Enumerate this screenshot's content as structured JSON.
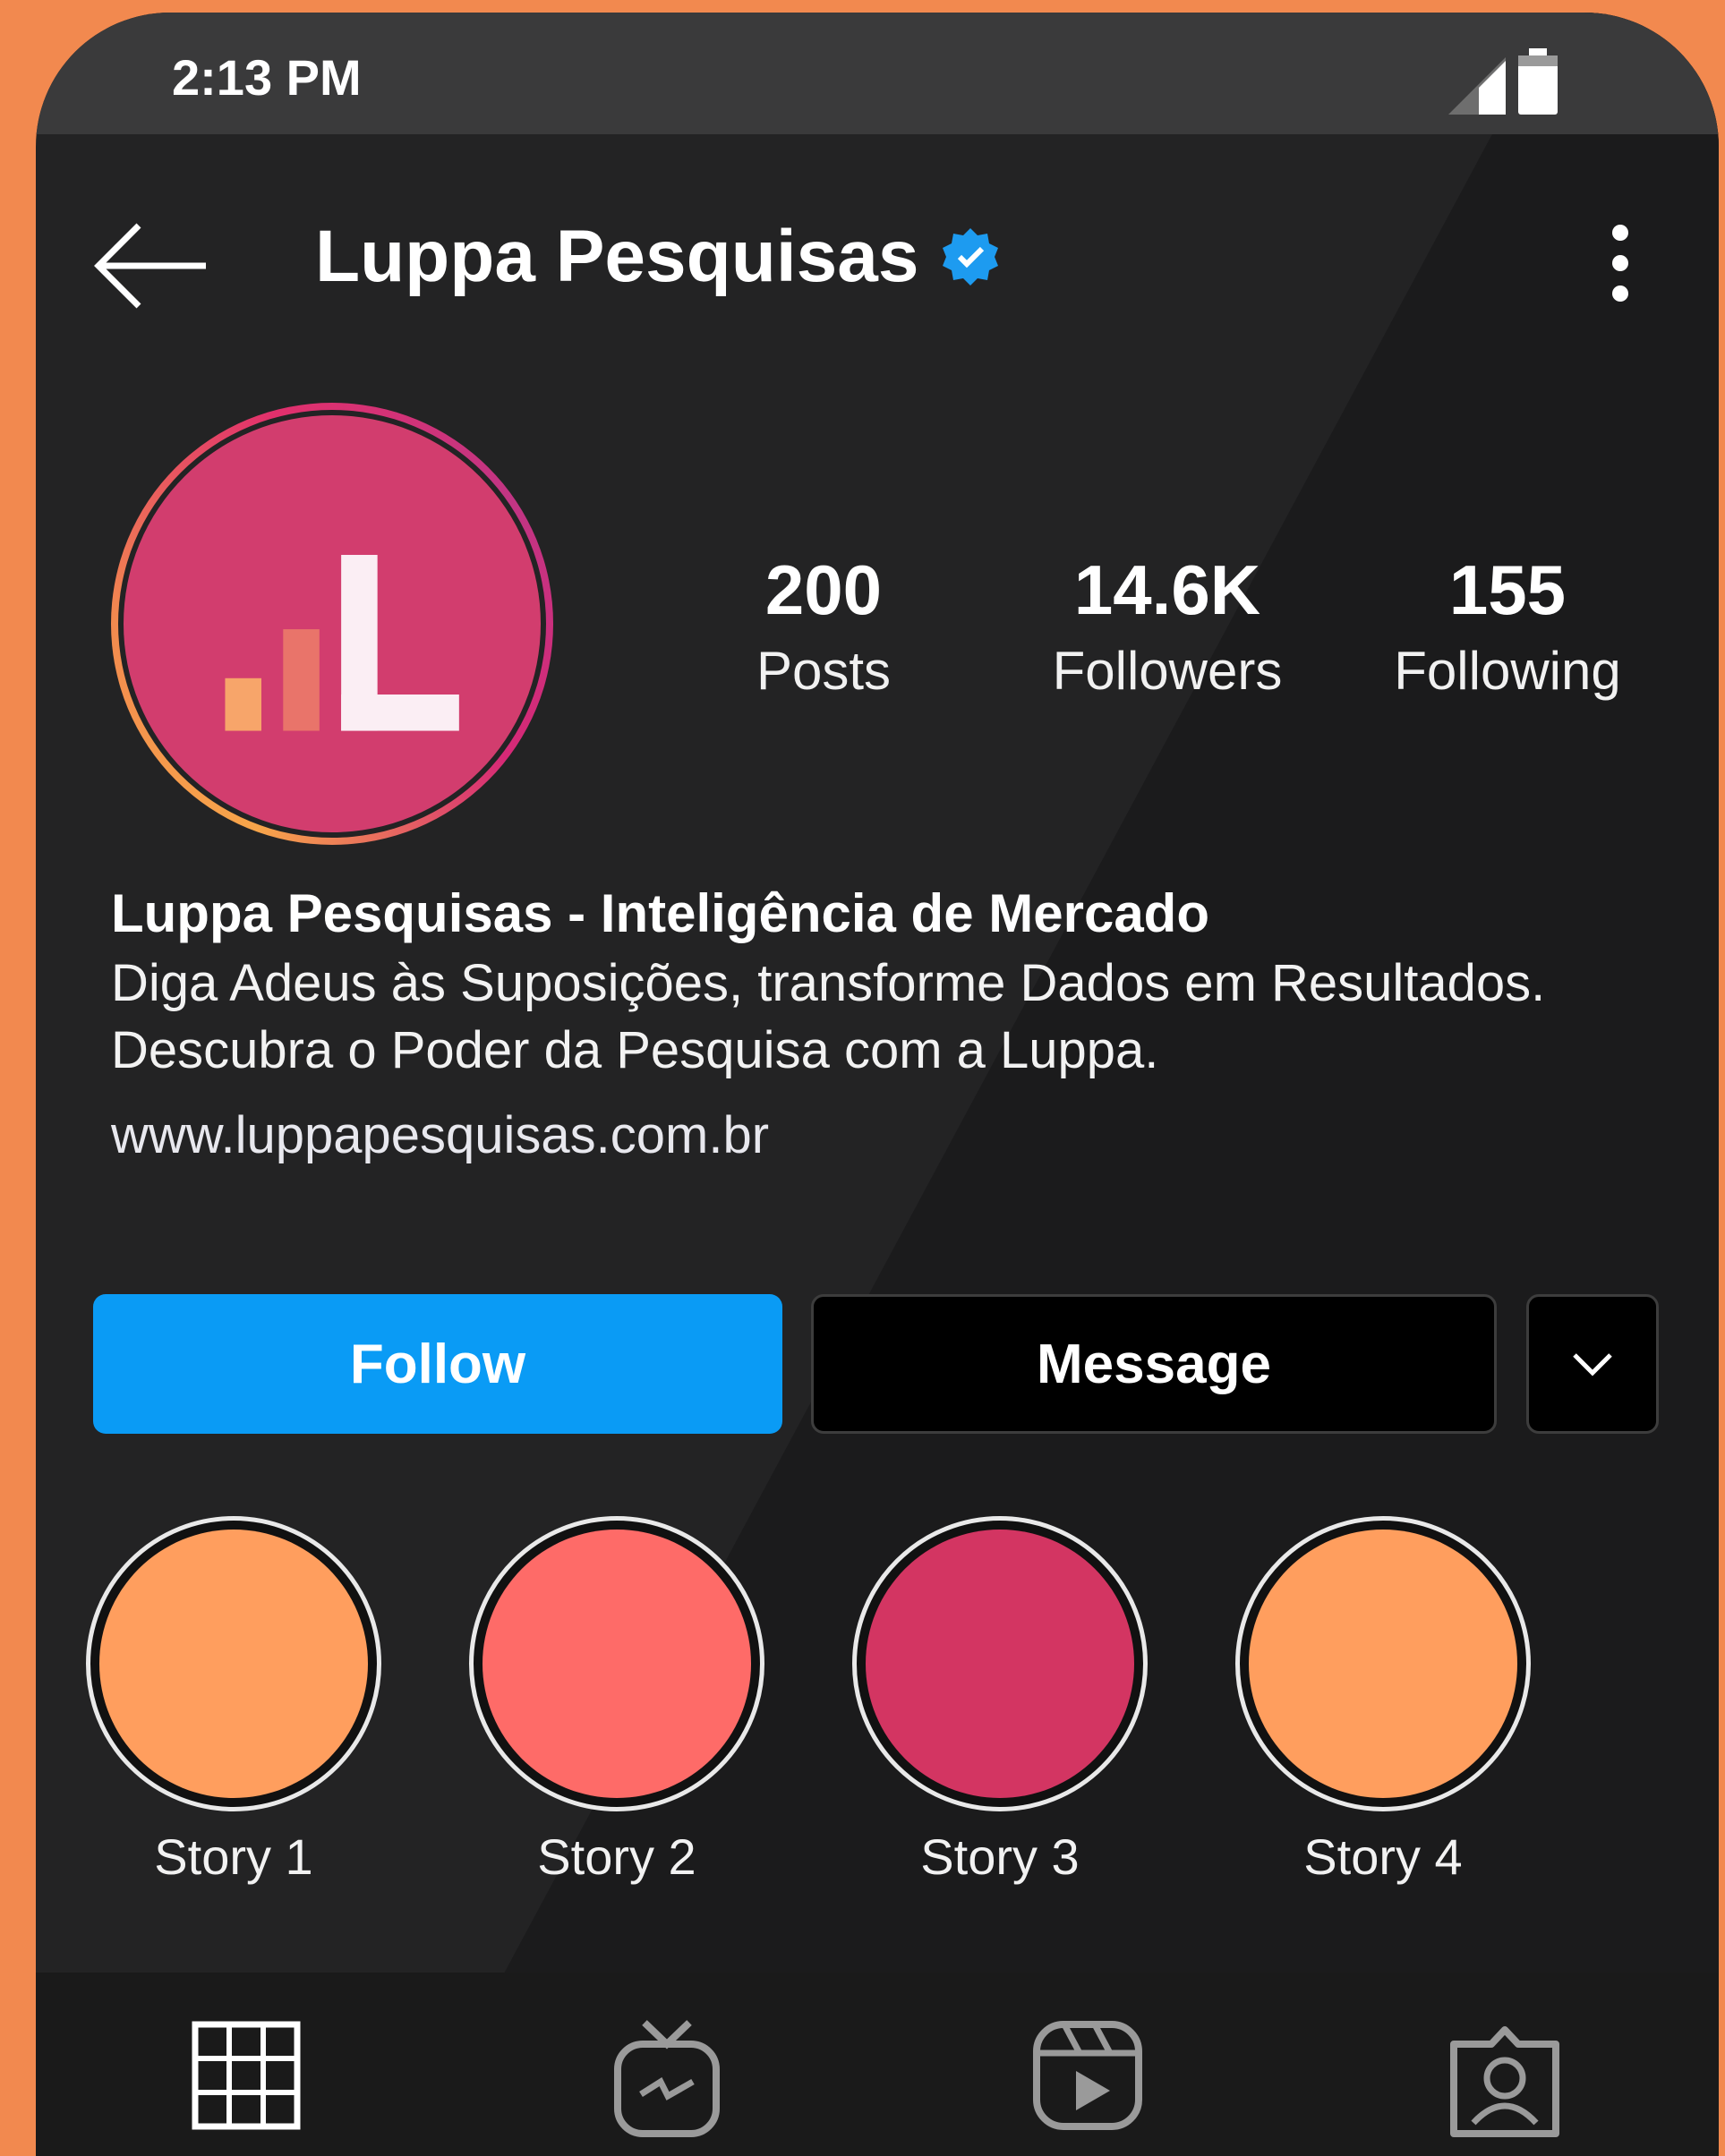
{
  "status_bar": {
    "time": "2:13 PM"
  },
  "header": {
    "title": "Luppa Pesquisas",
    "back_icon": "back-arrow-icon",
    "verified_icon": "verified-badge-icon",
    "more_icon": "more-vertical-icon"
  },
  "profile": {
    "stats": [
      {
        "value": "200",
        "label": "Posts"
      },
      {
        "value": "14.6K",
        "label": "Followers"
      },
      {
        "value": "155",
        "label": "Following"
      }
    ],
    "bio_name": "Luppa Pesquisas - Inteligência de Mercado",
    "bio_lines": [
      "Diga Adeus às Suposições, transforme Dados em Resultados.",
      "Descubra o Poder da Pesquisa com a Luppa."
    ],
    "website": "www.luppapesquisas.com.br"
  },
  "actions": {
    "follow_label": "Follow",
    "message_label": "Message",
    "more_icon": "chevron-down-icon"
  },
  "stories": [
    {
      "label": "Story 1",
      "color": "#ff9e5e"
    },
    {
      "label": "Story 2",
      "color": "#fe6b68"
    },
    {
      "label": "Story 3",
      "color": "#d33562"
    },
    {
      "label": "Story 4",
      "color": "#ff9e5e"
    }
  ],
  "tabs": [
    "grid-icon",
    "igtv-icon",
    "reels-icon",
    "tagged-icon"
  ],
  "colors": {
    "accent": "#0a9bf5",
    "brand": "#d23d6e",
    "background": "#232324",
    "frame": "#f2894f"
  }
}
